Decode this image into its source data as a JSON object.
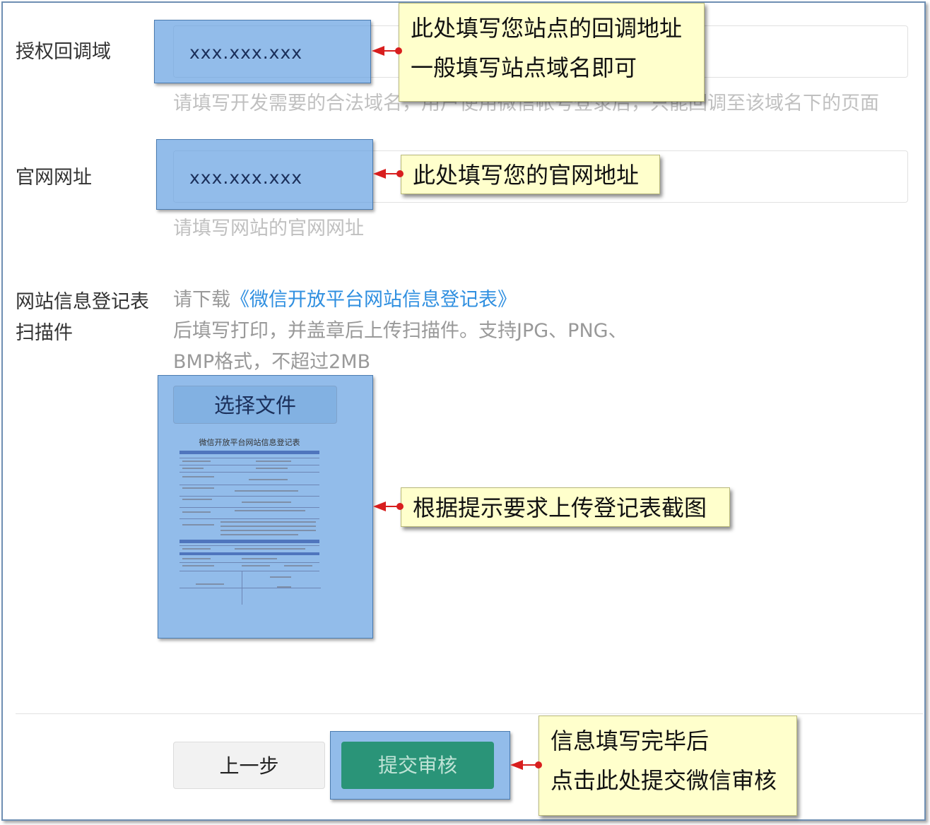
{
  "form": {
    "callback_domain": {
      "label": "授权回调域",
      "value": "xxx.xxx.xxx",
      "hint": "请填写开发需要的合法域名，用户使用微信帐号登录后，只能回调至该域名下的页面"
    },
    "website": {
      "label": "官网网址",
      "value": "xxx.xxx.xxx",
      "hint": "请填写网站的官网网址"
    },
    "registration_form": {
      "label_line1": "网站信息登记表",
      "label_line2": "扫描件",
      "desc_prefix": "请下载",
      "desc_link": "《微信开放平台网站信息登记表》",
      "desc_line2": "后填写打印，并盖章后上传扫描件。支持JPG、PNG、",
      "desc_line3": "BMP格式，不超过2MB",
      "select_file_label": "选择文件",
      "thumbnail_title": "微信开放平台网站信息登记表"
    }
  },
  "buttons": {
    "prev_label": "上一步",
    "submit_label": "提交审核"
  },
  "callouts": {
    "callback_line1": "此处填写您站点的回调地址",
    "callback_line2": "一般填写站点域名即可",
    "website": "此处填写您的官网地址",
    "upload": "根据提示要求上传登记表截图",
    "submit_line1": "信息填写完毕后",
    "submit_line2": "点击此处提交微信审核"
  },
  "colors": {
    "highlight": "#64a0e1",
    "callout_bg": "#ffffcc",
    "arrow": "#d81e1e",
    "submit_button": "#2a9478",
    "link": "#2f8fe0"
  }
}
